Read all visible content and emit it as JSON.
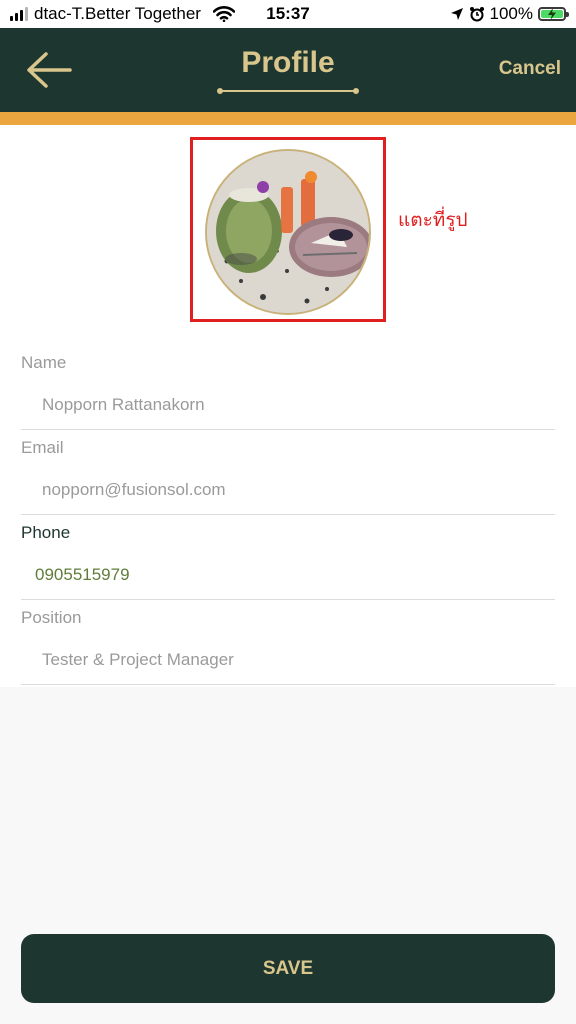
{
  "status_bar": {
    "carrier": "dtac-T.Better Together",
    "time": "15:37",
    "battery_percent": "100%",
    "battery_level": 1.0,
    "signal_bars_filled": 3,
    "signal_bars_total": 4,
    "icons": [
      "signal-icon",
      "wifi-icon",
      "location-arrow-icon",
      "alarm-clock-icon",
      "battery-charging-icon"
    ]
  },
  "header": {
    "title": "Profile",
    "cancel_label": "Cancel",
    "back_icon": "arrow-left-icon"
  },
  "profile_photo": {
    "hint": "แตะที่รูป"
  },
  "fields": {
    "name": {
      "label": "Name",
      "value": "Nopporn Rattanakorn"
    },
    "email": {
      "label": "Email",
      "value": "nopporn@fusionsol.com"
    },
    "phone": {
      "label": "Phone",
      "value": "0905515979"
    },
    "position": {
      "label": "Position",
      "value": "Tester & Project Manager"
    }
  },
  "save_label": "SAVE",
  "colors": {
    "header_bg": "#1e3630",
    "gold": "#d8c68c",
    "accent_bar": "#eba63f",
    "highlight_red": "#e02020",
    "phone_value": "#5f7d3a"
  }
}
